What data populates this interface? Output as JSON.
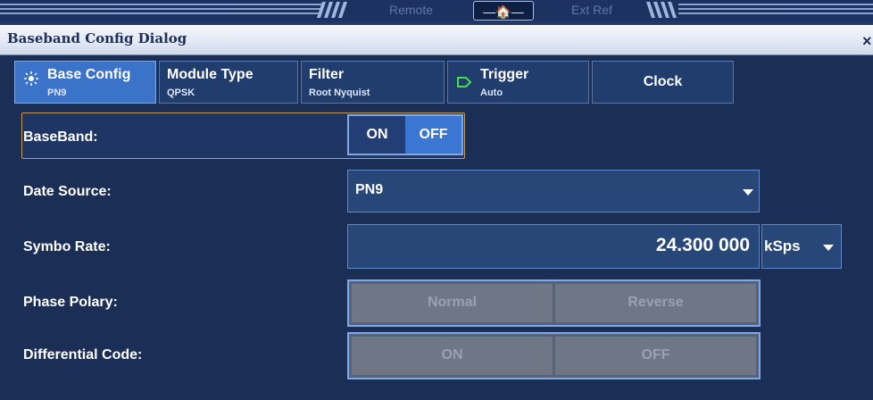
{
  "window": {
    "title": "Baseband Config Dialog",
    "close_glyph": "×"
  },
  "status": {
    "remote": "Remote",
    "home_glyph": "—🏠—",
    "ext_ref": "Ext Ref"
  },
  "tabs": [
    {
      "title": "Base Config",
      "subtitle": "PN9",
      "icon": "sun-icon"
    },
    {
      "title": "Module Type",
      "subtitle": "QPSK"
    },
    {
      "title": "Filter",
      "subtitle": "Root Nyquist"
    },
    {
      "title": "Trigger",
      "subtitle": "Auto",
      "icon": "pentagon-arrow-icon"
    },
    {
      "title": "Clock",
      "subtitle": ""
    }
  ],
  "baseband": {
    "label": "BaseBand:",
    "on": "ON",
    "off": "OFF",
    "selected": "OFF"
  },
  "data_source": {
    "label": "Date Source:",
    "value": "PN9"
  },
  "symbol_rate": {
    "label": "Symbo Rate:",
    "value": "24.300 000",
    "unit": "kSps"
  },
  "phase_polarity": {
    "label": "Phase Polary:",
    "options": [
      "Normal",
      "Reverse"
    ]
  },
  "differential_code": {
    "label": "Differential Code:",
    "options": [
      "ON",
      "OFF"
    ]
  },
  "colors": {
    "background": "#1b2e55",
    "active_tab": "#3b73c9",
    "toggle_selected": "#3b76d3",
    "highlight_border": "#c69a57",
    "disabled_button": "#6f7787",
    "icon_green": "#44e04f"
  }
}
